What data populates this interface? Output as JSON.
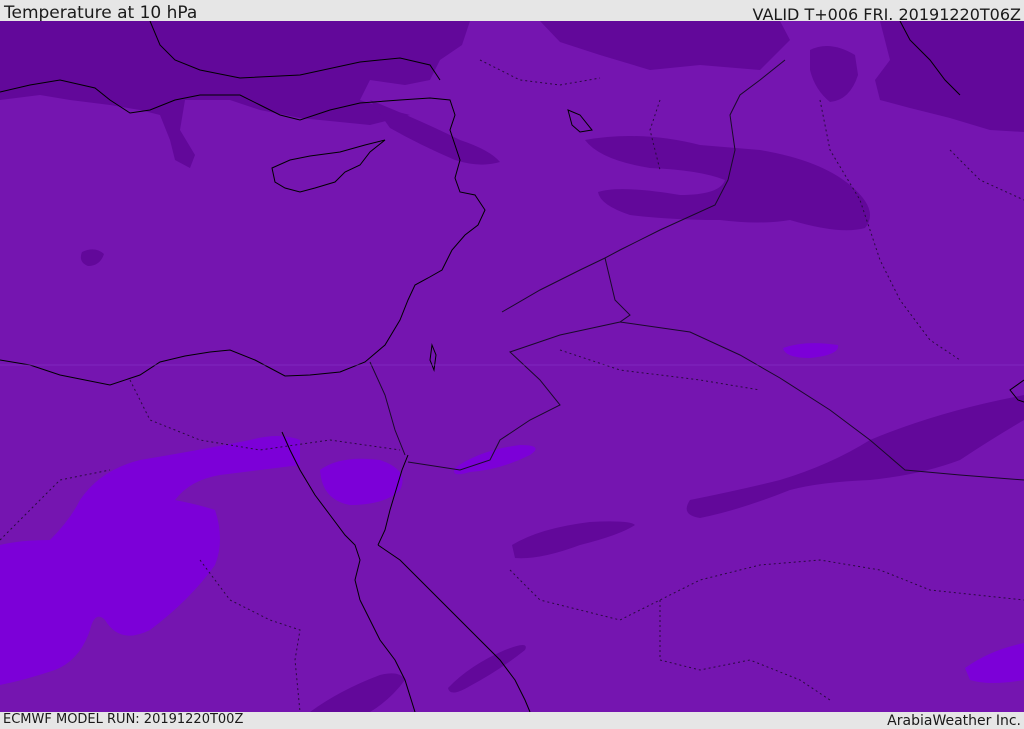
{
  "header": {
    "title": "Temperature at 10 hPa",
    "valid": "VALID T+006 FRI. 20191220T06Z"
  },
  "footer": {
    "model_run": "ECMWF MODEL RUN: 20191220T00Z",
    "credit": "ArabiaWeather Inc."
  },
  "colors": {
    "base_field": "#7515b0",
    "cold_band": "#62089a",
    "warm_band": "#7c00d8",
    "coastline": "#000000",
    "border": "#1a0a2a"
  }
}
